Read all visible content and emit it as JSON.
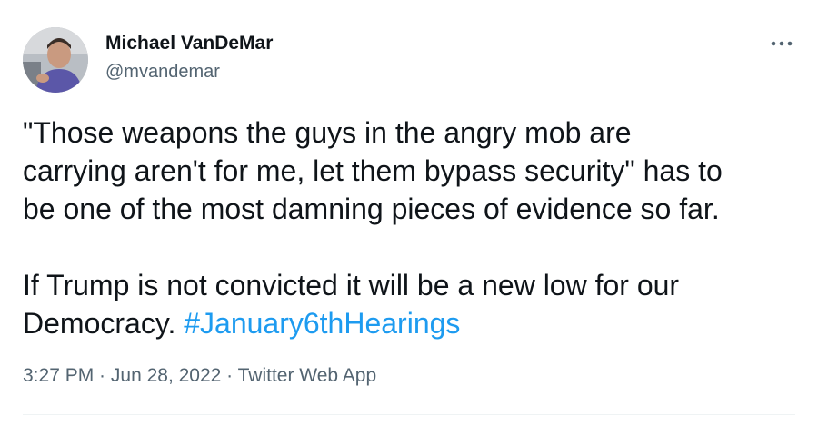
{
  "author": {
    "name": "Michael VanDeMar",
    "handle": "@mvandemar"
  },
  "more_icon": "more-horizontal-icon",
  "tweet": {
    "text_part1": "\"Those weapons the guys in the angry mob are\ncarrying aren't for me, let them bypass security\" has to\nbe one of the most damning pieces of evidence so far.\n\nIf Trump is not convicted it will be a new low for our\nDemocracy. ",
    "hashtag": "#January6thHearings"
  },
  "meta": {
    "time": "3:27 PM",
    "sep1": " · ",
    "date": "Jun 28, 2022",
    "sep2": " · ",
    "source": "Twitter Web App"
  },
  "colors": {
    "link": "#1d9bf0",
    "secondary_text": "#536471",
    "primary_text": "#0f1419"
  }
}
